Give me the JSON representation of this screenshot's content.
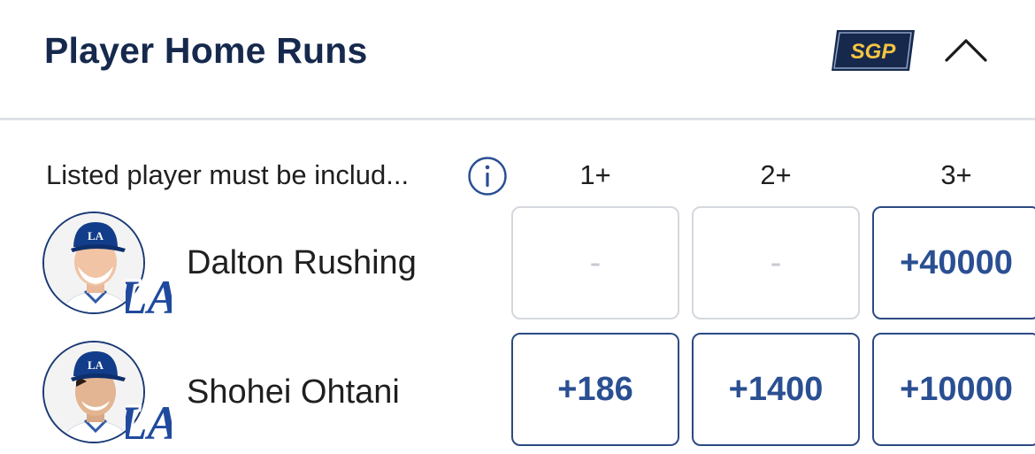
{
  "header": {
    "title": "Player Home Runs",
    "badge": "SGP"
  },
  "subheader": {
    "text": "Listed player must be includ..."
  },
  "columns": [
    "1+",
    "2+",
    "3+"
  ],
  "players": [
    {
      "name": "Dalton Rushing",
      "team_logo": "LA",
      "odds": [
        "-",
        "-",
        "+40000"
      ],
      "available": [
        false,
        false,
        true
      ]
    },
    {
      "name": "Shohei Ohtani",
      "team_logo": "LA",
      "odds": [
        "+186",
        "+1400",
        "+10000"
      ],
      "available": [
        true,
        true,
        true
      ]
    }
  ],
  "colors": {
    "navy": "#16294d",
    "odds_blue": "#2a4f92",
    "badge_gold": "#f5c542",
    "divider": "#dde2e8"
  },
  "icons": [
    "sgp-badge-icon",
    "chevron-up-icon",
    "info-icon",
    "la-dodgers-logo-icon"
  ]
}
